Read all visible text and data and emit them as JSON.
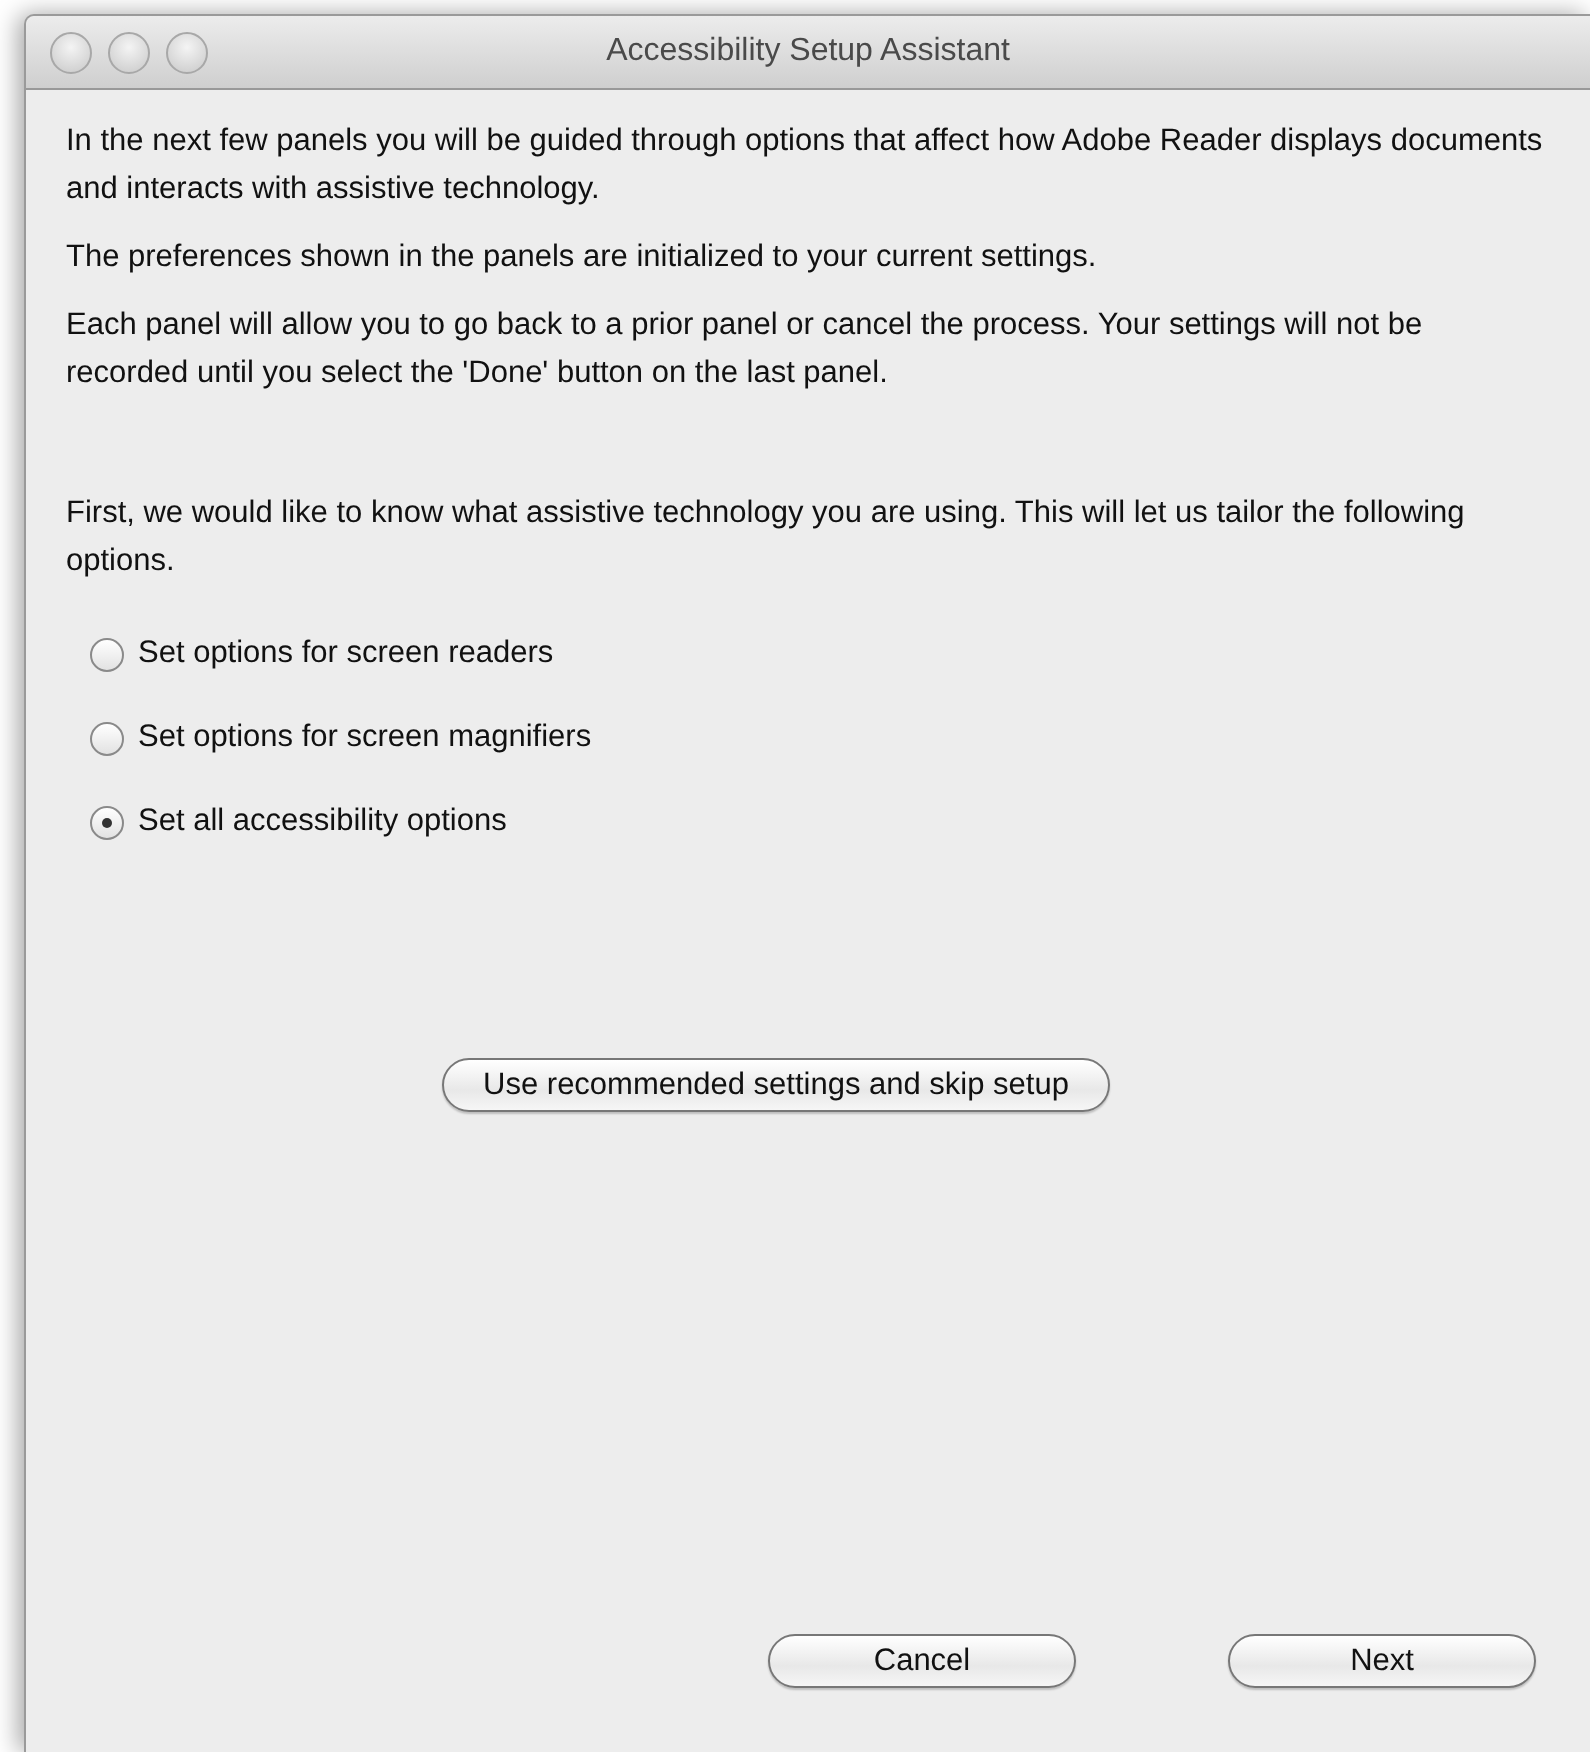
{
  "window": {
    "title": "Accessibility Setup Assistant"
  },
  "intro": [
    "In the next few panels you will be guided through options that affect how Adobe Reader displays documents and interacts with assistive technology.",
    "The preferences shown in the panels are initialized to your current settings.",
    "Each panel will allow you to go back to a prior panel or cancel the process. Your settings will not be recorded until you select the 'Done' button on the last panel."
  ],
  "question": "First, we would like to know what assistive technology you are using. This will let us tailor the following options.",
  "options": [
    {
      "label": "Set options for screen readers",
      "selected": false
    },
    {
      "label": "Set options for screen magnifiers",
      "selected": false
    },
    {
      "label": "Set all accessibility options",
      "selected": true
    }
  ],
  "skip_button": "Use recommended settings and skip setup",
  "buttons": [
    "Cancel",
    "Next"
  ]
}
